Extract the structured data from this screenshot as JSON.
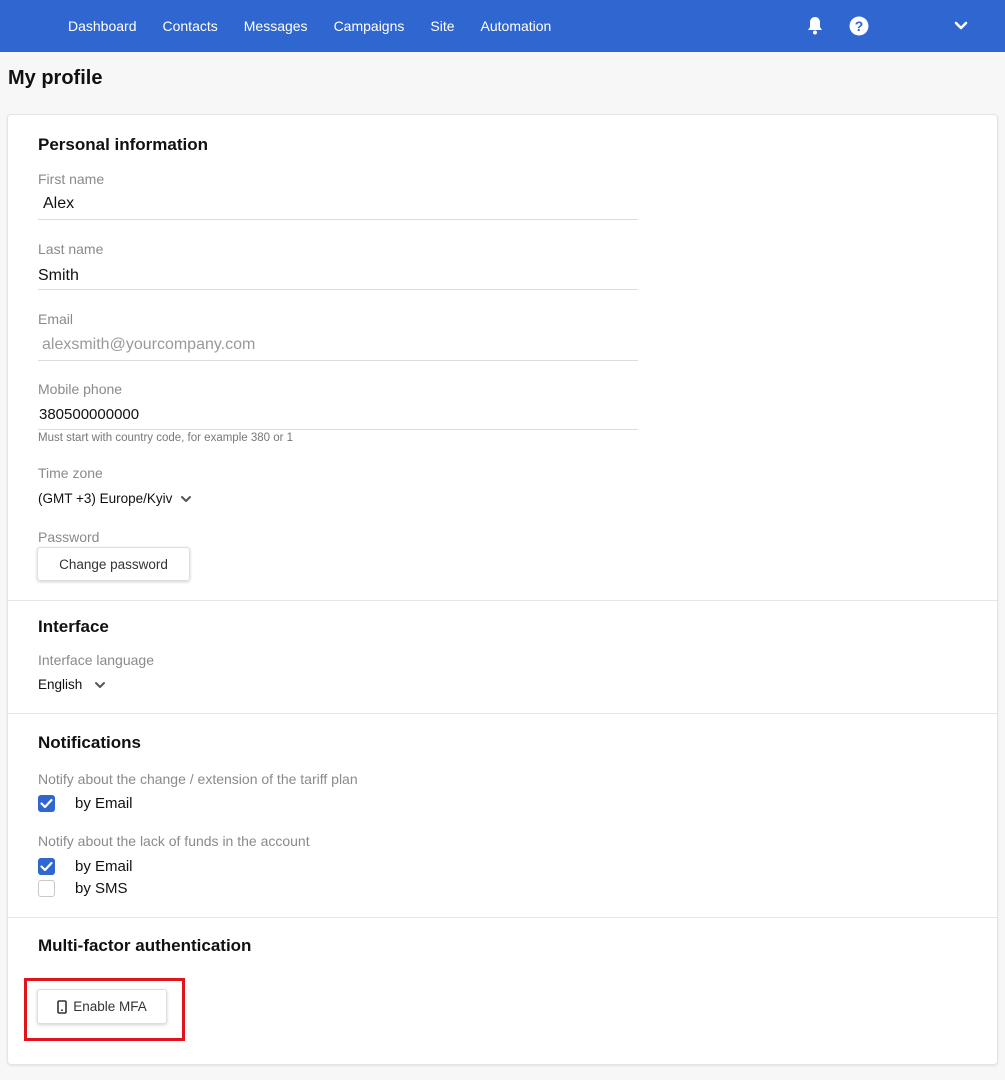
{
  "nav": {
    "items": [
      {
        "label": "Dashboard"
      },
      {
        "label": "Contacts"
      },
      {
        "label": "Messages"
      },
      {
        "label": "Campaigns"
      },
      {
        "label": "Site"
      },
      {
        "label": "Automation"
      }
    ],
    "icons": [
      "bell-icon",
      "help-icon",
      "chevron-down-icon"
    ]
  },
  "page": {
    "title": "My profile"
  },
  "personal": {
    "title": "Personal information",
    "first_name": {
      "label": "First name",
      "value": "Alex"
    },
    "last_name": {
      "label": "Last name",
      "value": "Smith"
    },
    "email": {
      "label": "Email",
      "value": "alexsmith@yourcompany.com"
    },
    "mobile": {
      "label": "Mobile phone",
      "value": "380500000000",
      "hint": "Must start with country code, for example 380 or 1"
    },
    "timezone": {
      "label": "Time zone",
      "value": "(GMT +3) Europe/Kyiv"
    },
    "password": {
      "label": "Password",
      "button": "Change password"
    }
  },
  "interface": {
    "title": "Interface",
    "language_label": "Interface language",
    "language_value": "English"
  },
  "notifications": {
    "title": "Notifications",
    "tariff_label": "Notify about the change / extension of the tariff plan",
    "tariff_email": {
      "label": "by Email",
      "checked": true
    },
    "funds_label": "Notify about the lack of funds in the account",
    "funds_email": {
      "label": "by Email",
      "checked": true
    },
    "funds_sms": {
      "label": "by SMS",
      "checked": false
    }
  },
  "mfa": {
    "title": "Multi-factor authentication",
    "button": "Enable MFA"
  },
  "colors": {
    "accent": "#2f66cf",
    "highlight": "#e0141c"
  }
}
